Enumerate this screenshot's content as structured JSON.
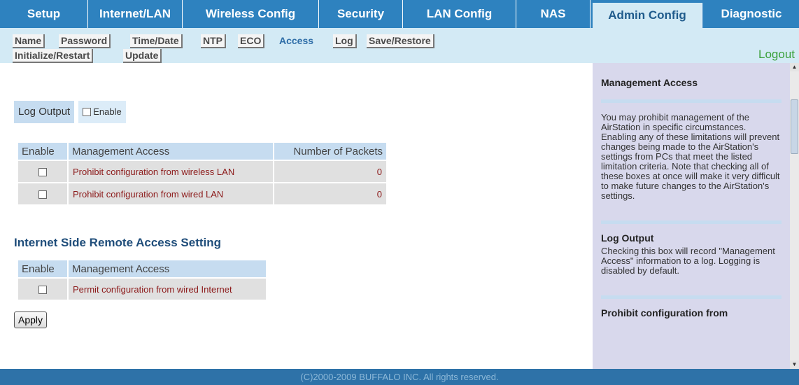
{
  "topnav": {
    "tabs": [
      "Setup",
      "Internet/LAN",
      "Wireless Config",
      "Security",
      "LAN Config",
      "NAS",
      "Admin Config",
      "Diagnostic"
    ]
  },
  "subnav": {
    "items": [
      "Name",
      "Password",
      "Time/Date",
      "NTP",
      "ECO",
      "Access",
      "Log",
      "Save/Restore",
      "Initialize/Restart",
      "Update"
    ],
    "logout": "Logout"
  },
  "log_output": {
    "label": "Log Output",
    "enable_label": "Enable"
  },
  "mgmt_table": {
    "headers": [
      "Enable",
      "Management Access",
      "Number of Packets"
    ],
    "rows": [
      {
        "label": "Prohibit configuration from wireless LAN",
        "packets": "0"
      },
      {
        "label": "Prohibit configuration from wired LAN",
        "packets": "0"
      }
    ]
  },
  "remote": {
    "title": "Internet Side Remote Access Setting",
    "headers": [
      "Enable",
      "Management Access"
    ],
    "rows": [
      {
        "label": "Permit configuration from wired Internet"
      }
    ]
  },
  "apply_label": "Apply",
  "help": {
    "s1_title": "Management Access",
    "s1_text": "You may prohibit management of the AirStation in specific circumstances. Enabling any of these limitations will prevent changes being made to the AirStation's settings from PCs that meet the listed limitation criteria. Note that checking all of these boxes at once will make it very difficult to make future changes to the AirStation's settings.",
    "s2_title": "Log Output",
    "s2_text": "Checking this box will record \"Management Access\" information to a log. Logging is disabled by default.",
    "s3_title": "Prohibit configuration from"
  },
  "footer": "(C)2000-2009 BUFFALO INC. All rights reserved."
}
